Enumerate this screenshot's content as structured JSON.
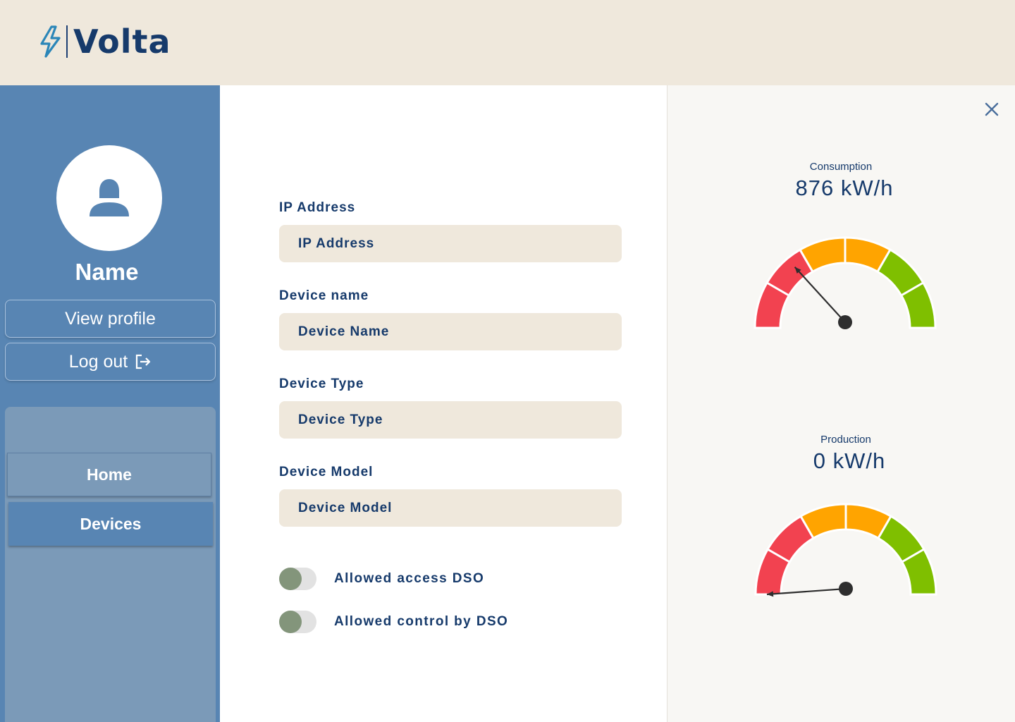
{
  "app": {
    "brand": "Volta",
    "colors": {
      "header_bg": "#efe8dc",
      "sidebar_bg": "#5885b3",
      "accent_dark": "#163a6b",
      "red": "#f24250",
      "orange": "#ffa400",
      "green": "#7fbf00"
    }
  },
  "header": {
    "logo_icon": "lightning-bolt-icon"
  },
  "sidebar": {
    "user_name": "Name",
    "avatar_icon": "user-icon",
    "view_profile_label": "View profile",
    "logout_label": "Log out",
    "logout_icon": "logout-icon",
    "nav": [
      {
        "label": "Home",
        "active": false
      },
      {
        "label": "Devices",
        "active": true
      }
    ]
  },
  "form": {
    "fields": [
      {
        "label": "IP Address",
        "value": "IP Address"
      },
      {
        "label": "Device name",
        "value": "Device Name"
      },
      {
        "label": "Device Type",
        "value": "Device Type"
      },
      {
        "label": "Device Model",
        "value": "Device Model"
      }
    ],
    "toggles": [
      {
        "label": "Allowed access DSO",
        "on": false
      },
      {
        "label": "Allowed control by DSO",
        "on": false
      }
    ]
  },
  "gauges": {
    "close_icon": "close-icon",
    "consumption": {
      "title": "Consumption",
      "value": "876 kW/h",
      "level": 0.28
    },
    "production": {
      "title": "Production",
      "value": "0 kW/h",
      "level": 0.0
    }
  }
}
